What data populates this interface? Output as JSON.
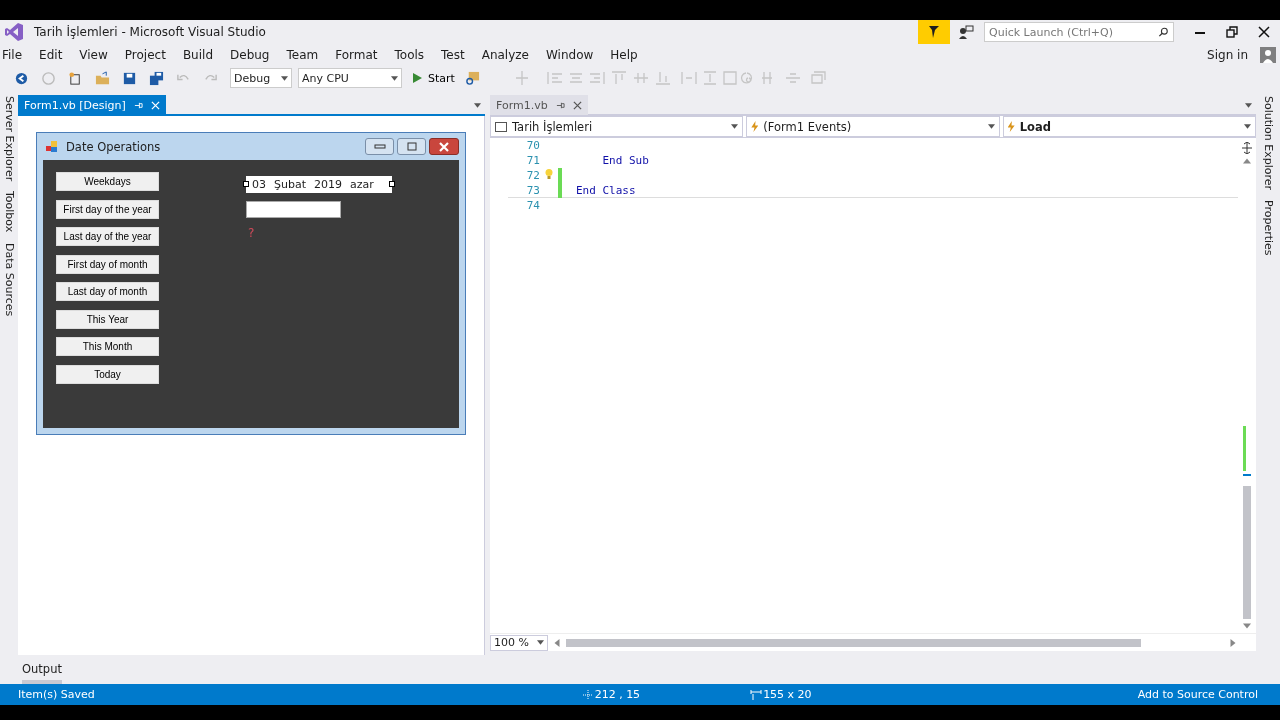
{
  "window": {
    "title": "Tarih İşlemleri - Microsoft Visual Studio"
  },
  "quick_launch": {
    "placeholder": "Quick Launch (Ctrl+Q)"
  },
  "menu": [
    "File",
    "Edit",
    "View",
    "Project",
    "Build",
    "Debug",
    "Team",
    "Format",
    "Tools",
    "Test",
    "Analyze",
    "Window",
    "Help"
  ],
  "sign_in": "Sign in",
  "toolbar": {
    "configuration": "Debug",
    "platform": "Any CPU",
    "start": "Start"
  },
  "left_side_tabs": [
    "Server Explorer",
    "Toolbox",
    "Data Sources"
  ],
  "right_side_tabs": [
    "Solution Explorer",
    "Properties"
  ],
  "designer_tab": {
    "label": "Form1.vb [Design]",
    "selected": true
  },
  "form": {
    "title": "Date Operations",
    "buttons": [
      "Weekdays",
      "First day of the year",
      "Last day of the year",
      "First day of month",
      "Last day of month",
      "This Year",
      "This Month",
      "Today"
    ],
    "date_picker": {
      "day": "03",
      "month": "Şubat",
      "year": "2019",
      "weekday": "azar"
    },
    "error_mark": "?"
  },
  "code_tab": {
    "label": "Form1.vb",
    "selected": false
  },
  "code_nav": [
    "Tarih İşlemleri",
    "(Form1 Events)",
    "Load"
  ],
  "code_lines": [
    {
      "number": "70"
    },
    {
      "number": "71",
      "code": "    End Sub"
    },
    {
      "number": "72"
    },
    {
      "number": "73",
      "code": "End Class"
    },
    {
      "number": "74"
    }
  ],
  "zoom": "100 %",
  "output_tab": "Output",
  "status_bar": {
    "message": "Item(s) Saved",
    "position": "212 , 15",
    "size": "155 x 20",
    "source_control": "Add to Source Control"
  }
}
